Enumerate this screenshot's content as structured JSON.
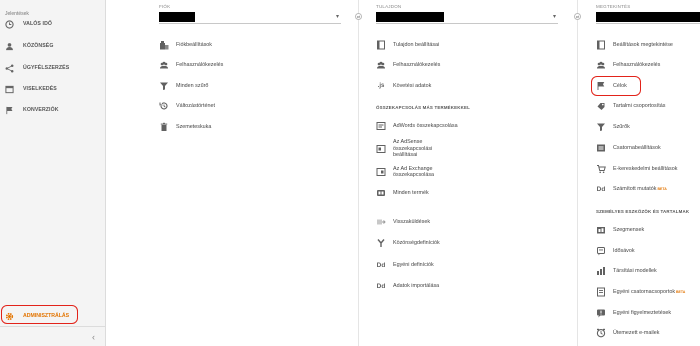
{
  "sidebar": {
    "section_label": "Jelentések",
    "items": [
      {
        "label": "VALÓS IDŐ",
        "icon": "clock-icon"
      },
      {
        "label": "KÖZÖNSÉG",
        "icon": "person-icon"
      },
      {
        "label": "ÜGYFÉLSZERZÉS",
        "icon": "acquisition-icon"
      },
      {
        "label": "VISELKEDÉS",
        "icon": "behavior-icon"
      },
      {
        "label": "KONVERZIÓK",
        "icon": "flag-icon"
      }
    ],
    "admin_label": "ADMINISZTRÁLÁS",
    "collapse_icon": "chevron-left-icon"
  },
  "account": {
    "header": "FIÓK",
    "items": [
      {
        "label": "Fiókbeállítások",
        "icon": "building-icon"
      },
      {
        "label": "Felhasználókezelés",
        "icon": "users-icon"
      },
      {
        "label": "Minden szűrő",
        "icon": "filter-icon"
      },
      {
        "label": "Változástörténet",
        "icon": "history-icon"
      },
      {
        "label": "Szemeteskuka",
        "icon": "trash-icon"
      }
    ]
  },
  "property": {
    "header": "TULAJDON",
    "items": [
      {
        "label": "Tulajdon beállításai",
        "icon": "settings-page-icon"
      },
      {
        "label": "Felhasználókezelés",
        "icon": "users-icon"
      },
      {
        "label": "Követési adatok",
        "icon": "js-icon"
      }
    ],
    "products_header": "ÖSSZEKAPCSOLÁS MÁS TERMÉKEKKEL",
    "products": [
      {
        "label": "AdWords összekapcsolása",
        "icon": "adwords-icon"
      },
      {
        "label": "Az AdSense összekapcsolási beállításai",
        "icon": "adsense-icon"
      },
      {
        "label": "Az Ad Exchange összekapcsolása",
        "icon": "adexchange-icon"
      },
      {
        "label": "Minden termék",
        "icon": "products-icon"
      }
    ],
    "extra": [
      {
        "label": "Visszaküldések",
        "icon": "postback-icon"
      },
      {
        "label": "Közönségdefiníciók",
        "icon": "audience-def-icon"
      },
      {
        "label": "Egyéni definíciók",
        "icon": "dd-icon",
        "glyph": "Dd"
      },
      {
        "label": "Adatok importálása",
        "icon": "dd-icon",
        "glyph": "Dd"
      }
    ]
  },
  "view": {
    "header": "MEGTEKINTÉS",
    "items": [
      {
        "label": "Beállítások megtekintése",
        "icon": "settings-page-icon"
      },
      {
        "label": "Felhasználókezelés",
        "icon": "users-icon"
      },
      {
        "label": "Célok",
        "icon": "flag-icon"
      },
      {
        "label": "Tartalmi csoportosítás",
        "icon": "content-group-icon"
      },
      {
        "label": "Szűrők",
        "icon": "filter-icon"
      },
      {
        "label": "Csatornabeállítások",
        "icon": "channel-icon"
      },
      {
        "label": "E-kereskedelmi beállítások",
        "icon": "cart-icon"
      },
      {
        "label": "Számított mutatók",
        "icon": "dd-icon",
        "glyph": "Dd",
        "badge": "BETA"
      }
    ],
    "personal_header": "SZEMÉLYES ESZKÖZÖK ÉS TARTALMAK",
    "personal": [
      {
        "label": "Szegmensek",
        "icon": "segments-icon"
      },
      {
        "label": "Idősávok",
        "icon": "annotations-icon"
      },
      {
        "label": "Társítási modellek",
        "icon": "attribution-icon"
      },
      {
        "label": "Egyéni csatornacsoportok",
        "icon": "custom-channel-icon",
        "badge": "BETA"
      },
      {
        "label": "Egyéni figyelmeztetések",
        "icon": "alerts-icon"
      },
      {
        "label": "Ütemezett e-mailek",
        "icon": "email-icon"
      }
    ]
  },
  "colors": {
    "accent": "#e37400",
    "highlight": "#e2231a",
    "icon": "#616161"
  }
}
